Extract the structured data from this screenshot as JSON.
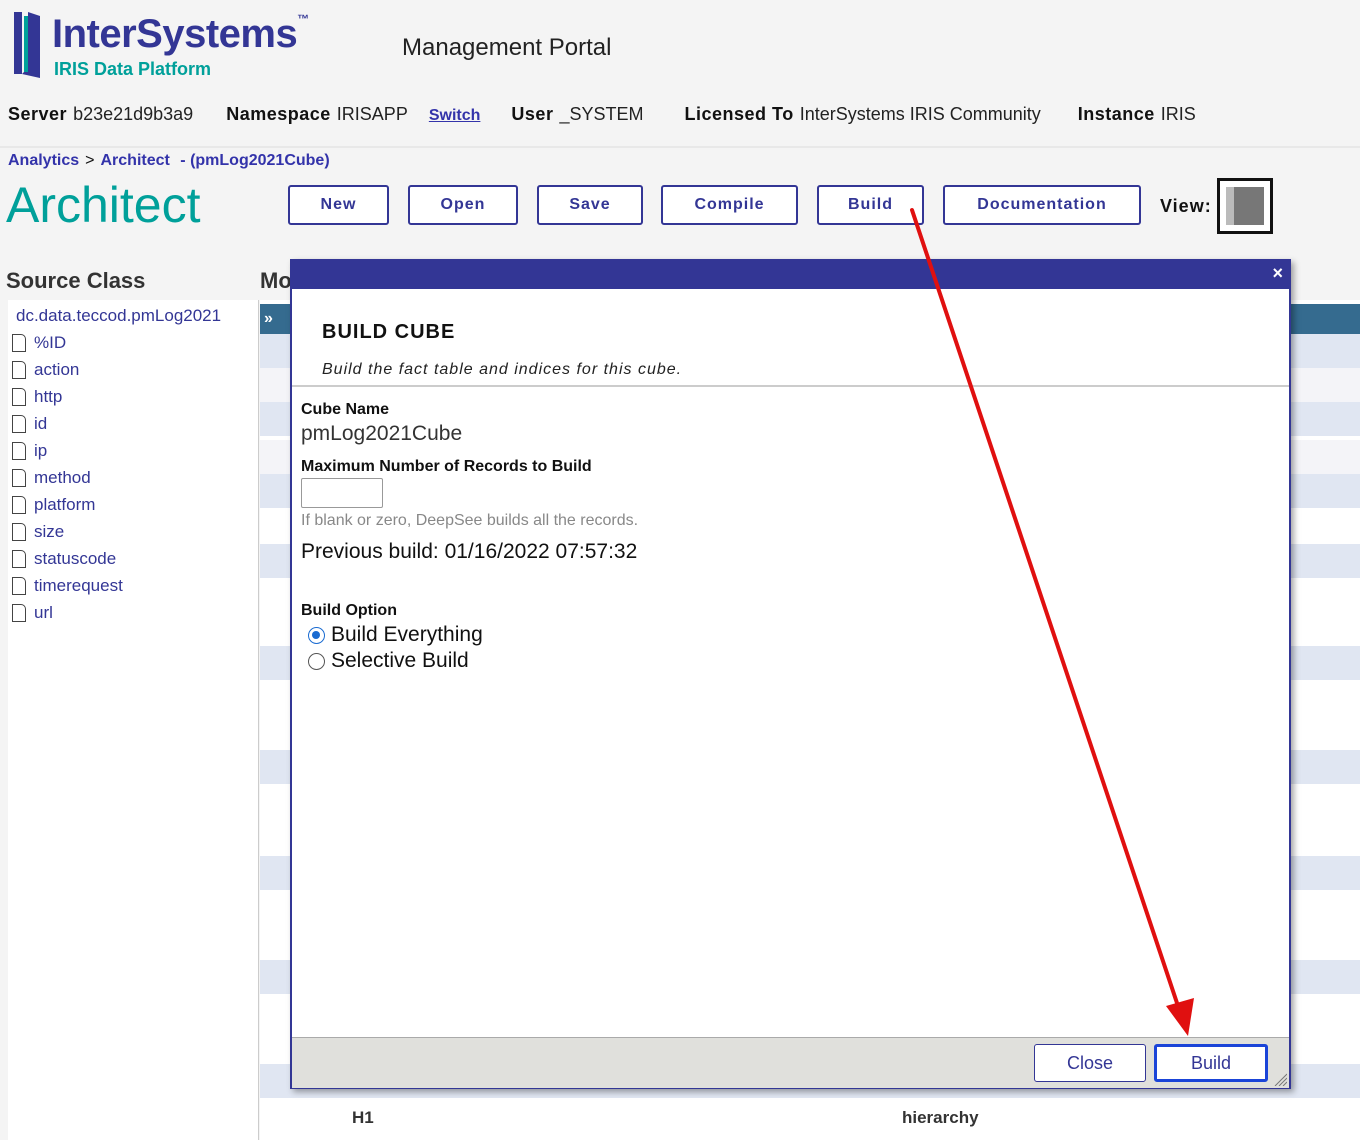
{
  "header": {
    "brand_name": "InterSystems",
    "brand_tm": "™",
    "brand_sub": "IRIS Data Platform",
    "portal_title": "Management Portal",
    "server_label": "Server",
    "server_value": "b23e21d9b3a9",
    "namespace_label": "Namespace",
    "namespace_value": "IRISAPP",
    "switch_link": "Switch",
    "user_label": "User",
    "user_value": "_SYSTEM",
    "licensed_label": "Licensed To",
    "licensed_value": "InterSystems IRIS Community",
    "instance_label": "Instance",
    "instance_value": "IRIS"
  },
  "breadcrumb": {
    "analytics": "Analytics",
    "sep": ">",
    "architect": "Architect",
    "cube": "- (pmLog2021Cube)"
  },
  "page_title": "Architect",
  "toolbar": {
    "new": "New",
    "open": "Open",
    "save": "Save",
    "compile": "Compile",
    "build": "Build",
    "documentation": "Documentation",
    "view_label": "View:"
  },
  "source_class": {
    "heading": "Source Class",
    "root": "dc.data.teccod.pmLog2021",
    "items": [
      "%ID",
      "action",
      "http",
      "id",
      "ip",
      "method",
      "platform",
      "size",
      "statuscode",
      "timerequest",
      "url"
    ]
  },
  "model": {
    "heading": "Mo",
    "topbar": "»",
    "row_h1": "H1",
    "row_type": "hierarchy"
  },
  "modal": {
    "close_x": "×",
    "heading": "BUILD CUBE",
    "subtitle": "Build the fact table and indices for this cube.",
    "cube_name_label": "Cube Name",
    "cube_name_value": "pmLog2021Cube",
    "max_records_label": "Maximum Number of Records to Build",
    "max_records_value": "",
    "hint": "If blank or zero, DeepSee builds all the records.",
    "previous_build": "Previous build: 01/16/2022 07:57:32",
    "build_option_label": "Build Option",
    "option_everything": "Build Everything",
    "option_selective": "Selective Build",
    "close_button": "Close",
    "build_button": "Build"
  },
  "colors": {
    "brand": "#333695",
    "accent": "#00a09a",
    "annotation_arrow": "#e01010"
  }
}
